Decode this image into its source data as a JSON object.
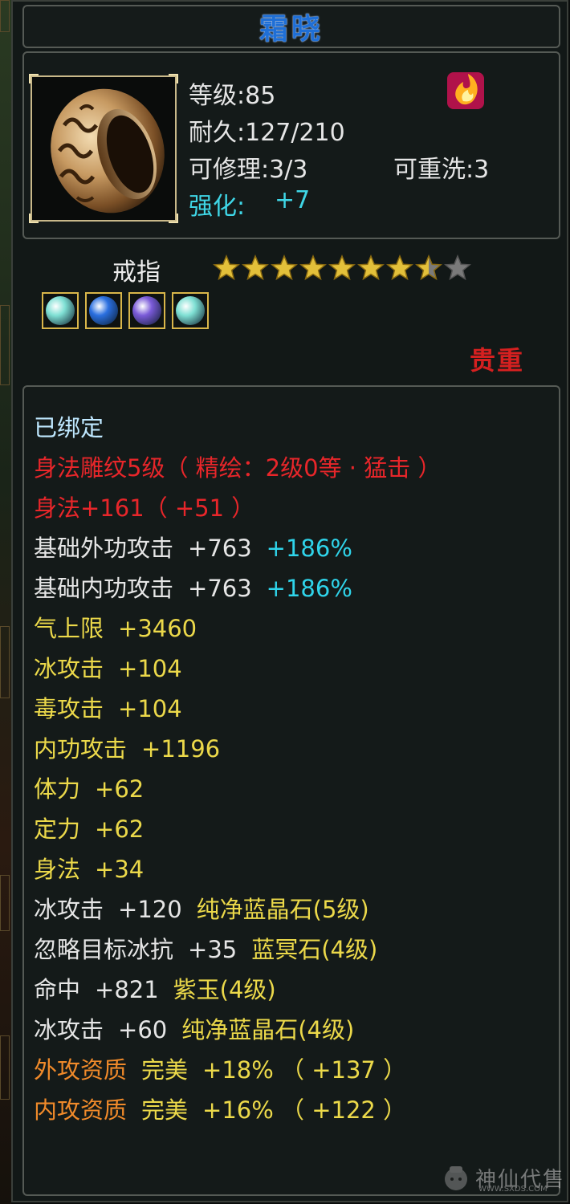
{
  "item": {
    "name": "霜晓",
    "level_label": "等级:85",
    "durability_label": "耐久:127/210",
    "repairable_label": "可修理:3/3",
    "rewash_label": "可重洗:3",
    "enhance_label": "强化:",
    "enhance_value": "+7",
    "type": "戒指",
    "star_rating": 7.5,
    "star_max": 9,
    "rarity": "贵重",
    "bound": "已绑定"
  },
  "gems": [
    {
      "name": "cyan-gem",
      "color": "#7fe0d4"
    },
    {
      "name": "blue-gem",
      "color": "#2a6fe0"
    },
    {
      "name": "purple-gem",
      "color": "#7a5ad8"
    },
    {
      "name": "cyan-gem",
      "color": "#7fe0d4"
    }
  ],
  "attributes": [
    {
      "segments": [
        {
          "text": "身法雕纹5级（ 精绘：2级0等 · 猛击 ）",
          "color": "red"
        }
      ]
    },
    {
      "segments": [
        {
          "text": "身法+161（ +51 ）",
          "color": "red"
        }
      ]
    },
    {
      "segments": [
        {
          "text": "基础外功攻击",
          "color": "white"
        },
        {
          "text": "+763",
          "color": "white"
        },
        {
          "text": "+186%",
          "color": "cyan"
        }
      ]
    },
    {
      "segments": [
        {
          "text": "基础内功攻击",
          "color": "white"
        },
        {
          "text": "+763",
          "color": "white"
        },
        {
          "text": "+186%",
          "color": "cyan"
        }
      ]
    },
    {
      "segments": [
        {
          "text": "气上限",
          "color": "yellow"
        },
        {
          "text": "+3460",
          "color": "yellow"
        }
      ]
    },
    {
      "segments": [
        {
          "text": "冰攻击",
          "color": "yellow"
        },
        {
          "text": "+104",
          "color": "yellow"
        }
      ]
    },
    {
      "segments": [
        {
          "text": "毒攻击",
          "color": "yellow"
        },
        {
          "text": "+104",
          "color": "yellow"
        }
      ]
    },
    {
      "segments": [
        {
          "text": "内功攻击",
          "color": "yellow"
        },
        {
          "text": "+1196",
          "color": "yellow"
        }
      ]
    },
    {
      "segments": [
        {
          "text": "体力",
          "color": "yellow"
        },
        {
          "text": "+62",
          "color": "yellow"
        }
      ]
    },
    {
      "segments": [
        {
          "text": "定力",
          "color": "yellow"
        },
        {
          "text": "+62",
          "color": "yellow"
        }
      ]
    },
    {
      "segments": [
        {
          "text": "身法",
          "color": "yellow"
        },
        {
          "text": "+34",
          "color": "yellow"
        }
      ]
    },
    {
      "segments": [
        {
          "text": "冰攻击",
          "color": "white"
        },
        {
          "text": "+120",
          "color": "white"
        },
        {
          "text": "纯净蓝晶石(5级)",
          "color": "yellow"
        }
      ]
    },
    {
      "segments": [
        {
          "text": "忽略目标冰抗",
          "color": "white"
        },
        {
          "text": "+35",
          "color": "white"
        },
        {
          "text": "蓝冥石(4级)",
          "color": "yellow"
        }
      ]
    },
    {
      "segments": [
        {
          "text": "命中",
          "color": "white"
        },
        {
          "text": "+821",
          "color": "white"
        },
        {
          "text": "紫玉(4级)",
          "color": "yellow"
        }
      ]
    },
    {
      "segments": [
        {
          "text": "冰攻击",
          "color": "white"
        },
        {
          "text": "+60",
          "color": "white"
        },
        {
          "text": "纯净蓝晶石(4级)",
          "color": "yellow"
        }
      ]
    },
    {
      "segments": [
        {
          "text": "外攻资质",
          "color": "orange"
        },
        {
          "text": "完美",
          "color": "yellow"
        },
        {
          "text": "+18% （ +137 ）",
          "color": "yellow"
        }
      ]
    },
    {
      "segments": [
        {
          "text": "内攻资质",
          "color": "orange"
        },
        {
          "text": "完美",
          "color": "yellow"
        },
        {
          "text": "+16% （ +122 ）",
          "color": "yellow"
        }
      ]
    }
  ],
  "watermark": {
    "text": "神仙代售",
    "url": "WWW.SXDS.COM"
  }
}
